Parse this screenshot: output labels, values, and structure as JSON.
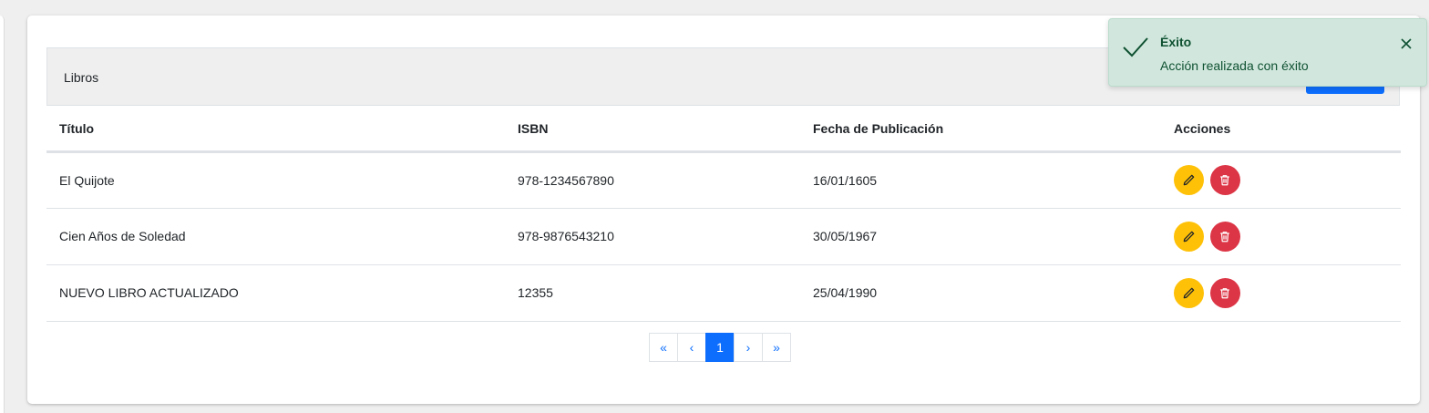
{
  "card": {
    "header_title": "Libros"
  },
  "table": {
    "headers": [
      "Título",
      "ISBN",
      "Fecha de Publicación",
      "Acciones"
    ],
    "rows": [
      {
        "title": "El Quijote",
        "isbn": "978-1234567890",
        "date": "16/01/1605"
      },
      {
        "title": "Cien Años de Soledad",
        "isbn": "978-9876543210",
        "date": "30/05/1967"
      },
      {
        "title": "NUEVO LIBRO ACTUALIZADO",
        "isbn": "12355",
        "date": "25/04/1990"
      }
    ]
  },
  "pagination": {
    "first": "«",
    "prev": "‹",
    "current": "1",
    "next": "›",
    "last": "»"
  },
  "toast": {
    "title": "Éxito",
    "message": "Acción realizada con éxito"
  },
  "icons": {
    "edit": "pencil-icon",
    "delete": "trash-icon",
    "success": "check-icon",
    "close": "close-icon"
  },
  "colors": {
    "primary": "#0d6efd",
    "edit": "#ffc107",
    "delete": "#dc3545",
    "toast_bg": "#d1e7dd",
    "toast_text": "#0f5132"
  }
}
